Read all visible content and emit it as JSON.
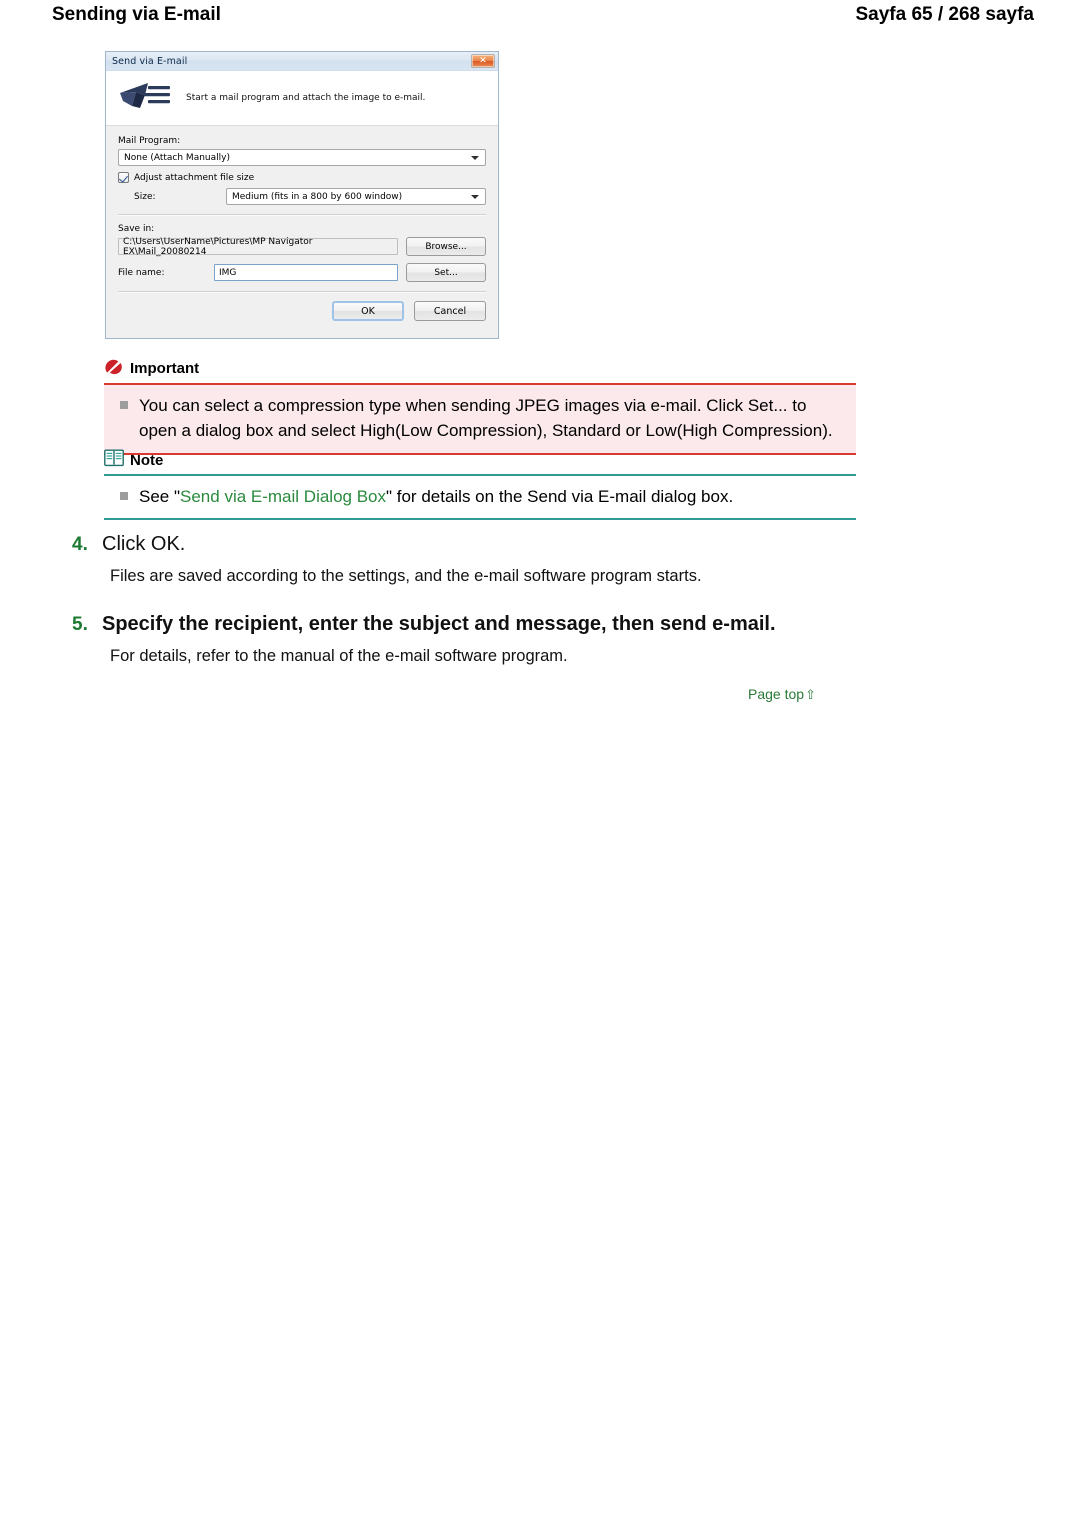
{
  "header": {
    "title": "Sending via E-mail",
    "pager": "Sayfa 65 / 268 sayfa"
  },
  "dialog": {
    "title": "Send via E-mail",
    "close_label": "✕",
    "banner_text": "Start a mail program and attach the image to e-mail.",
    "mail_program_label": "Mail Program:",
    "mail_program_value": "None (Attach Manually)",
    "adjust_checkbox_label": "Adjust attachment file size",
    "adjust_checkbox_checked": "true",
    "size_label": "Size:",
    "size_value": "Medium (fits in a 800 by 600 window)",
    "save_in_label": "Save in:",
    "save_in_value": "C:\\Users\\UserName\\Pictures\\MP Navigator EX\\Mail_20080214",
    "browse_label": "Browse...",
    "file_name_label": "File name:",
    "file_name_value": "IMG",
    "set_label": "Set...",
    "ok_label": "OK",
    "cancel_label": "Cancel"
  },
  "important": {
    "heading": "Important",
    "icon": "no-entry-icon",
    "accent": "#d9392f",
    "background": "#fbe9ec",
    "bullets": [
      "You can select a compression type when sending JPEG images via e-mail. Click Set... to open a dialog box and select High(Low Compression), Standard or Low(High Compression)."
    ]
  },
  "note": {
    "heading": "Note",
    "icon": "open-book-icon",
    "accent": "#2f9b94",
    "bullet_prefix": "See \"",
    "bullet_link": "Send via E-mail Dialog Box",
    "bullet_suffix": "\" for details on the Send via E-mail dialog box."
  },
  "steps": [
    {
      "number": "4.",
      "title": "Click OK.",
      "description": "Files are saved according to the settings, and the e-mail software program starts."
    },
    {
      "number": "5.",
      "title": "Specify the recipient, enter the subject and message, then send e-mail.",
      "description": "For details, refer to the manual of the e-mail software program."
    }
  ],
  "footer": {
    "page_top_label": "Page top",
    "page_top_arrow": "⇧",
    "color": "#2a7a37"
  }
}
